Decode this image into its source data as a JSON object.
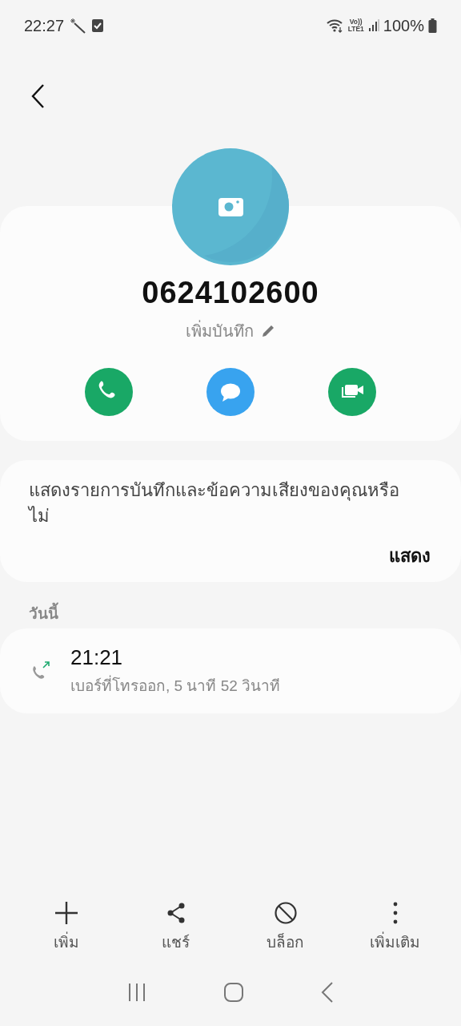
{
  "status_bar": {
    "time": "22:27",
    "volte": "Vo))",
    "network": "LTE1",
    "battery": "100%"
  },
  "contact": {
    "number": "0624102600",
    "note_label": "เพิ่มบันทึก",
    "actions": [
      {
        "kind": "call"
      },
      {
        "kind": "message"
      },
      {
        "kind": "video"
      }
    ]
  },
  "prompt": {
    "text": "แสดงรายการบันทึกและข้อความเสียงของคุณหรือไม่",
    "action": "แสดง"
  },
  "history": {
    "section": "วันนี้",
    "calls": [
      {
        "kind": "outgoing",
        "time": "21:21",
        "detail": "เบอร์ที่โทรออก, 5 นาที 52 วินาที"
      }
    ]
  },
  "bottom_actions": [
    {
      "kind": "add",
      "label": "เพิ่ม"
    },
    {
      "kind": "share",
      "label": "แชร์"
    },
    {
      "kind": "block",
      "label": "บล็อก"
    },
    {
      "kind": "more",
      "label": "เพิ่มเติม"
    }
  ]
}
